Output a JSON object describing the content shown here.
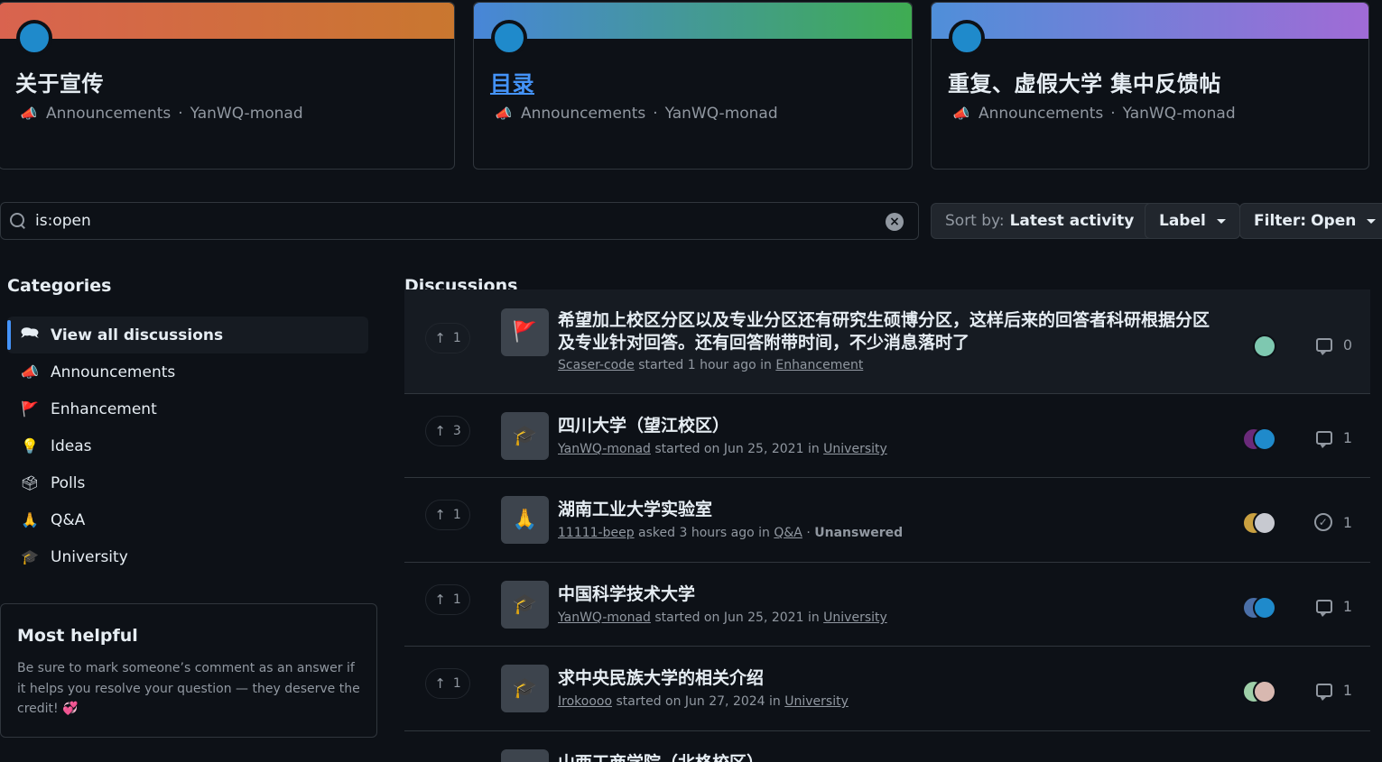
{
  "pinned": [
    {
      "title": "关于宣传",
      "category": "Announcements",
      "separator": "·",
      "author": "YanWQ-monad",
      "gradient": [
        "#d9634f",
        "#c9772f"
      ],
      "link": false
    },
    {
      "title": "目录",
      "category": "Announcements",
      "separator": "·",
      "author": "YanWQ-monad",
      "gradient": [
        "#4886d8",
        "#3fac52"
      ],
      "link": true
    },
    {
      "title": "重复、虚假大学 集中反馈帖",
      "category": "Announcements",
      "separator": "·",
      "author": "YanWQ-monad",
      "gradient": [
        "#4f8fd9",
        "#a06bd6"
      ],
      "link": false
    }
  ],
  "search": {
    "value": "is:open",
    "clear_icon": "x-circle-fill-icon"
  },
  "toolbar": {
    "sort_prefix": "Sort by:",
    "sort_value": "Latest activity",
    "label": "Label",
    "filter_prefix": "Filter:",
    "filter_value": "Open"
  },
  "sidebar": {
    "title": "Categories",
    "items": [
      {
        "label": "View all discussions",
        "icon": "comment-discussion-icon",
        "glyph": "🗪",
        "active": true
      },
      {
        "label": "Announcements",
        "icon": "megaphone-icon",
        "glyph": "📣"
      },
      {
        "label": "Enhancement",
        "icon": "red-flag-icon",
        "glyph": "🚩"
      },
      {
        "label": "Ideas",
        "icon": "light-bulb-icon",
        "glyph": "💡"
      },
      {
        "label": "Polls",
        "icon": "ballot-box-icon",
        "glyph": "🗳"
      },
      {
        "label": "Q&A",
        "icon": "folded-hands-icon",
        "glyph": "🙏"
      },
      {
        "label": "University",
        "icon": "graduation-cap-icon",
        "glyph": "🎓"
      }
    ]
  },
  "most_helpful": {
    "title": "Most helpful",
    "text": "Be sure to mark someone’s comment as an answer if it helps you resolve your question — they deserve the credit!",
    "heart": "💞"
  },
  "discussions_title": "Discussions",
  "discussions": [
    {
      "votes": "1",
      "glyph": "🚩",
      "icon": "red-flag-icon",
      "title": "希望加上校区分区以及专业分区还有研究生硕博分区，这样后来的回答者科研根据分区及专业针对回答。还有回答附带时间，不少消息落时了",
      "author": "Scaser-code",
      "verb": "started 1 hour ago in",
      "category": "Enhancement",
      "status": "",
      "comments": "0",
      "answered": false,
      "avatar_colors": [
        "#7ec8b0"
      ]
    },
    {
      "votes": "3",
      "glyph": "🎓",
      "icon": "graduation-cap-icon",
      "title": "四川大学（望江校区）",
      "author": "YanWQ-monad",
      "verb": "started on Jun 25, 2021 in",
      "category": "University",
      "status": "",
      "comments": "1",
      "answered": false,
      "avatar_colors": [
        "#6a2a7a",
        "#1f8acb"
      ]
    },
    {
      "votes": "1",
      "glyph": "🙏",
      "icon": "folded-hands-icon",
      "title": "湖南工业大学实验室",
      "author": "11111-beep",
      "verb": "asked 3 hours ago in",
      "category": "Q&A",
      "status": "Unanswered",
      "comments": "1",
      "answered": true,
      "avatar_colors": [
        "#c9a040",
        "#c7c9d0"
      ]
    },
    {
      "votes": "1",
      "glyph": "🎓",
      "icon": "graduation-cap-icon",
      "title": "中国科学技术大学",
      "author": "YanWQ-monad",
      "verb": "started on Jun 25, 2021 in",
      "category": "University",
      "status": "",
      "comments": "1",
      "answered": false,
      "avatar_colors": [
        "#4a6fa8",
        "#1f8acb"
      ]
    },
    {
      "votes": "1",
      "glyph": "🎓",
      "icon": "graduation-cap-icon",
      "title": "求中央民族大学的相关介绍",
      "author": "Irokoooo",
      "verb": "started on Jun 27, 2024 in",
      "category": "University",
      "status": "",
      "comments": "1",
      "answered": false,
      "avatar_colors": [
        "#9ecfa8",
        "#d8b8b0"
      ]
    },
    {
      "votes": "",
      "glyph": "",
      "icon": "",
      "title": "山西工商学院（北格校区）",
      "author": "",
      "verb": "",
      "category": "",
      "status": "",
      "comments": "",
      "answered": false,
      "avatar_colors": []
    }
  ]
}
